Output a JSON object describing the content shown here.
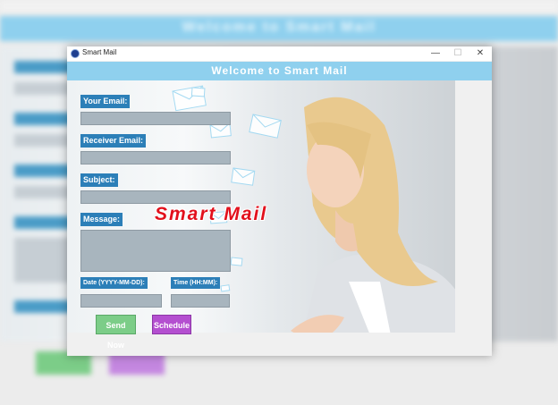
{
  "background_window": {
    "banner_text": "Welcome to Smart Mail"
  },
  "window": {
    "title": "Smart Mail",
    "controls": {
      "minimize": "—",
      "maximize": "☐",
      "close": "✕"
    }
  },
  "header": {
    "title": "Welcome to Smart Mail"
  },
  "form": {
    "your_email_label": "Your Email:",
    "your_email_value": "",
    "receiver_email_label": "Receiver Email:",
    "receiver_email_value": "",
    "subject_label": "Subject:",
    "subject_value": "",
    "message_label": "Message:",
    "message_value": "",
    "date_label": "Date (YYYY-MM-DD):",
    "date_value": "",
    "time_label": "Time (HH:MM):",
    "time_value": ""
  },
  "overlay_text": "Smart Mail",
  "buttons": {
    "send_now": "Send Now",
    "schedule": "Schedule"
  },
  "colors": {
    "header_bg": "#8fd0ee",
    "label_bg": "#2c7fb8",
    "field_bg": "#a8b5be",
    "send_button": "#7ccd88",
    "schedule_button": "#b44fd0",
    "overlay_text": "#e2101c"
  },
  "icons": [
    "app-icon",
    "envelope-icon"
  ]
}
